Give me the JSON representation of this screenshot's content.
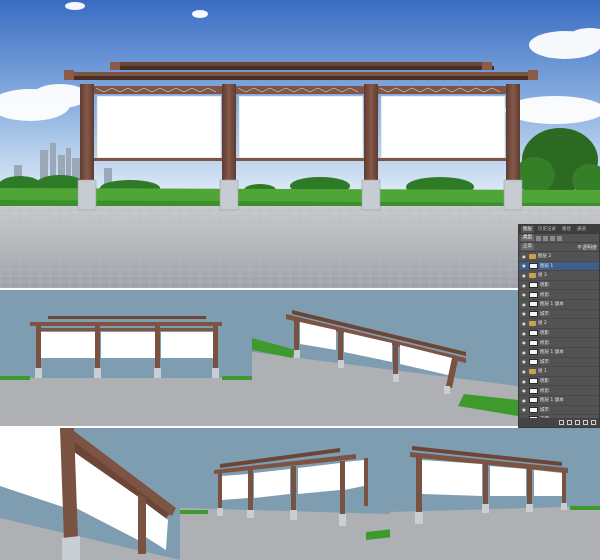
{
  "layers_panel": {
    "tabs": [
      "图层",
      "历史记录",
      "路径",
      "通道"
    ],
    "active_tab": 0,
    "kind_label": "类型",
    "blend_label": "正常",
    "opacity_label": "不透明度",
    "layers": [
      {
        "name": "图层 2",
        "type": "folder"
      },
      {
        "name": "图层 1",
        "type": "layer",
        "selected": true
      },
      {
        "name": "组 3",
        "type": "folder"
      },
      {
        "name": "阴影",
        "type": "layer"
      },
      {
        "name": "修剪",
        "type": "layer"
      },
      {
        "name": "图层 1 副本",
        "type": "layer"
      },
      {
        "name": "城市",
        "type": "layer"
      },
      {
        "name": "组 2",
        "type": "folder"
      },
      {
        "name": "阴影",
        "type": "layer"
      },
      {
        "name": "修剪",
        "type": "layer"
      },
      {
        "name": "图层 1 副本",
        "type": "layer"
      },
      {
        "name": "城市",
        "type": "layer"
      },
      {
        "name": "组 1",
        "type": "folder"
      },
      {
        "name": "阴影",
        "type": "layer"
      },
      {
        "name": "修剪",
        "type": "layer"
      },
      {
        "name": "图层 1 副本",
        "type": "layer"
      },
      {
        "name": "城市",
        "type": "layer"
      },
      {
        "name": "天空",
        "type": "layer"
      }
    ]
  },
  "colors": {
    "sky_top": "#3d6fc4",
    "sky_bottom": "#dfeaf6",
    "wood": "#7a5242",
    "wood_dark": "#4d2f25",
    "pavement": "#a9abaf",
    "pavement_far": "#c4c6ca",
    "grass": "#3f9a2e",
    "tree_dark": "#2f6f23",
    "backdrop_blue": "#7f9db1",
    "base_stone": "#c9ced3",
    "panel_white": "#ffffff"
  },
  "icons": [
    "eye-icon",
    "folder-icon",
    "lock-icon",
    "link-icon",
    "fx-icon",
    "mask-icon",
    "new-layer-icon",
    "trash-icon"
  ]
}
